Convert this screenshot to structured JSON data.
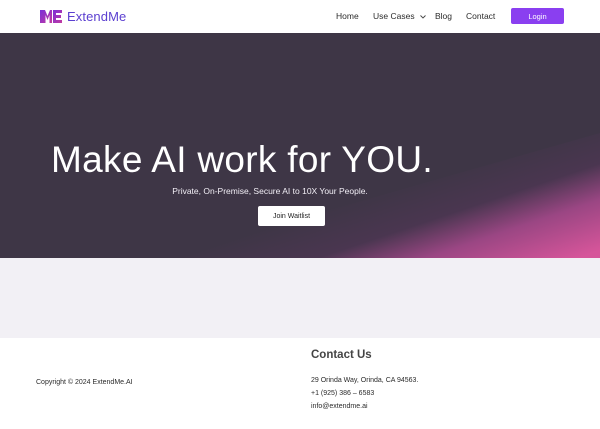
{
  "header": {
    "logo_text": "ExtendMe",
    "nav": {
      "home": "Home",
      "use_cases": "Use Cases",
      "blog": "Blog",
      "contact": "Contact"
    },
    "login_label": "Login"
  },
  "hero": {
    "title": "Make AI work for YOU.",
    "subtitle": "Private, On-Premise, Secure AI to 10X Your People.",
    "cta_label": "Join Waitlist"
  },
  "footer": {
    "copyright": "Copyright © 2024 ExtendMe.AI",
    "contact_title": "Contact Us",
    "address": "29 Orinda Way, Orinda, CA 94563.",
    "phone": "+1 (925) 386 – 6583",
    "email": "info@extendme.ai"
  },
  "colors": {
    "brand": "#5b3fd0",
    "login_button": "#8a3ff0",
    "hero_dark": "#3e3646",
    "hero_pink": "#d6559a",
    "band": "#f2f0f5"
  },
  "icons": {
    "logo": "extendme-logo-icon",
    "use_cases_dropdown": "chevron-down-icon"
  }
}
